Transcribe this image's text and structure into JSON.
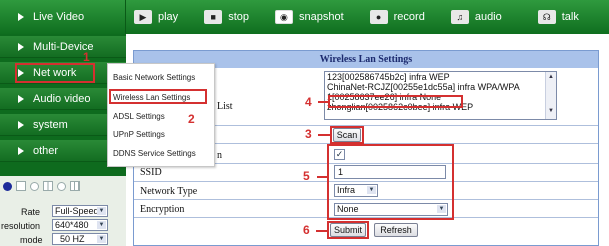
{
  "topbar": {
    "live_video": "Live Video",
    "play": "play",
    "stop": "stop",
    "snapshot": "snapshot",
    "record": "record",
    "audio": "audio",
    "talk": "talk"
  },
  "sidebar": {
    "items": [
      {
        "label": "Multi-Device"
      },
      {
        "label": "Net work"
      },
      {
        "label": "Audio video"
      },
      {
        "label": "system"
      },
      {
        "label": "other"
      }
    ]
  },
  "controls": {
    "rate_label": "Rate",
    "rate_value": "Full-Speed",
    "resolution_label": "resolution",
    "resolution_value": "640*480",
    "mode_label": "mode",
    "mode_value": "50 HZ"
  },
  "popup_menu": {
    "items": [
      {
        "label": "Basic Network Settings"
      },
      {
        "label": "Wireless Lan Settings"
      },
      {
        "label": "ADSL Settings"
      },
      {
        "label": "UPnP Settings"
      },
      {
        "label": "DDNS Service Settings"
      }
    ]
  },
  "settings": {
    "title": "Wireless Lan Settings",
    "list_label": "List",
    "network_list": [
      "123[002586745b2c] infra WEP",
      "ChinaNet-RCJZ[00255e1dc55a] infra WPA/WPA",
      "1[00258637ee26] infra None",
      "zhonglian[0025862c0bee] infra WEP"
    ],
    "scan_button": "Scan",
    "using_label_tail": "n",
    "ssid_label": "SSID",
    "ssid_value": "1",
    "network_type_label": "Network Type",
    "network_type_value": "Infra",
    "encryption_label": "Encryption",
    "encryption_value": "None",
    "submit_button": "Submit",
    "refresh_button": "Refresh"
  },
  "annotations": {
    "m1": "1",
    "m2": "2",
    "m3": "3",
    "m4": "4",
    "m5": "5",
    "m6": "6"
  },
  "icons": [
    "play-icon",
    "stop-icon",
    "camera-icon",
    "record-icon",
    "audio-icon",
    "talk-icon",
    "checkmark-icon"
  ],
  "colors": {
    "accent_green": "#1f8a30",
    "title_bar": "#a9c2ea",
    "annotation_red": "#d43030"
  }
}
